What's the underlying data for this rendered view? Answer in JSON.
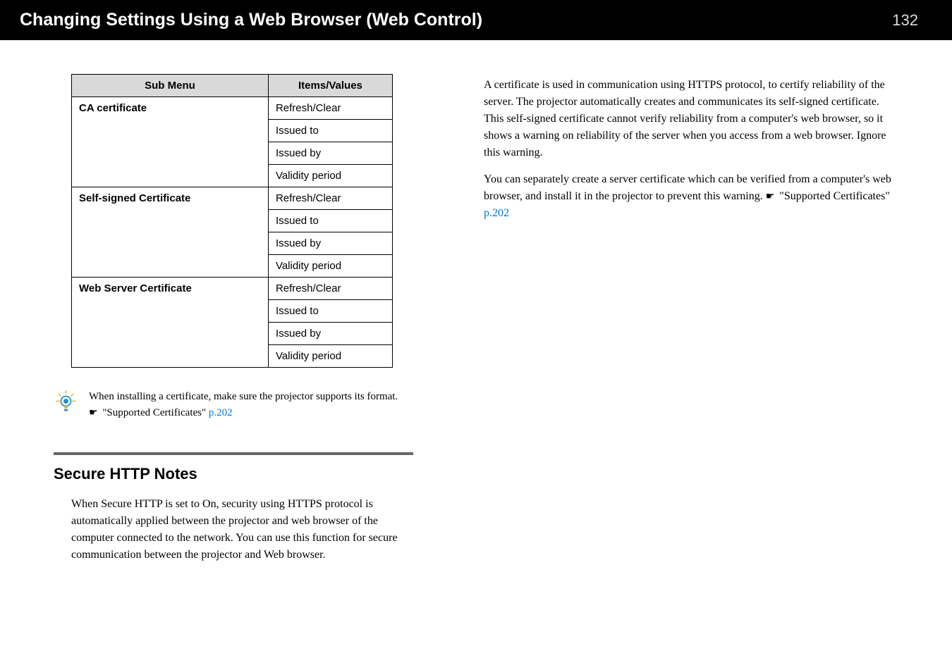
{
  "header": {
    "title": "Changing Settings Using a Web Browser (Web Control)",
    "page_number": "132"
  },
  "table": {
    "headers": [
      "Sub Menu",
      "Items/Values"
    ],
    "groups": [
      {
        "label": "CA certificate",
        "rows": [
          "Refresh/Clear",
          "Issued to",
          "Issued by",
          "Validity period"
        ]
      },
      {
        "label": "Self-signed Certificate",
        "rows": [
          "Refresh/Clear",
          "Issued to",
          "Issued by",
          "Validity period"
        ]
      },
      {
        "label": "Web Server Certificate",
        "rows": [
          "Refresh/Clear",
          "Issued to",
          "Issued by",
          "Validity period"
        ]
      }
    ]
  },
  "note": {
    "line1": "When installing a certificate, make sure the projector supports its format.",
    "ref_text": "\"Supported Certificates\"",
    "ref_page": " p.202"
  },
  "section": {
    "heading": "Secure HTTP Notes",
    "body": "When Secure HTTP is set to On, security using HTTPS protocol is automatically applied between the projector and web browser of the computer connected to the network. You can use this function for secure communication between the projector and Web browser."
  },
  "right": {
    "para1": "A certificate is used in communication using HTTPS protocol, to certify reliability of the server. The projector automatically creates and communicates its self-signed certificate. This self-signed certificate cannot verify reliability from a computer's web browser, so it shows a warning on reliability of the server when you access from a web browser. Ignore this warning.",
    "para2_a": "You can separately create a server certificate which can be verified from a computer's web browser, and install it in the projector to prevent this warning.",
    "ref_text": "\"Supported Certificates\"",
    "ref_page": " p.202"
  }
}
